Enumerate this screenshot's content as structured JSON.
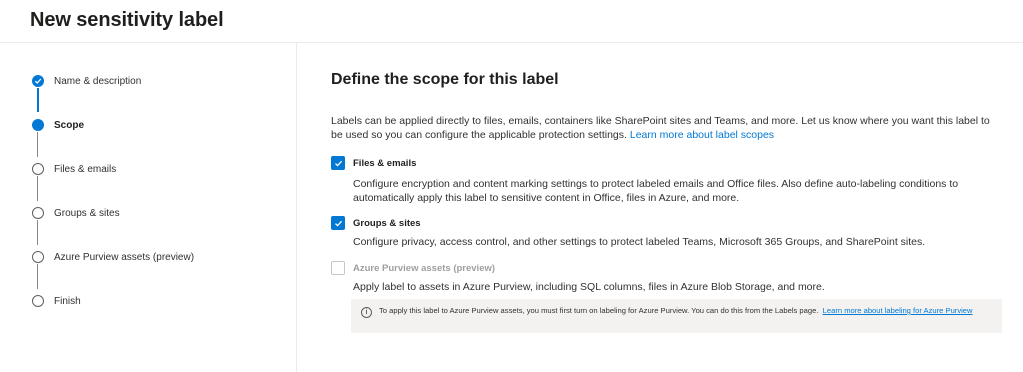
{
  "page": {
    "title": "New sensitivity label"
  },
  "wizard": {
    "steps": [
      {
        "label": "Name & description",
        "state": "completed"
      },
      {
        "label": "Scope",
        "state": "current"
      },
      {
        "label": "Files & emails",
        "state": "pending"
      },
      {
        "label": "Groups & sites",
        "state": "pending"
      },
      {
        "label": "Azure Purview assets (preview)",
        "state": "pending"
      },
      {
        "label": "Finish",
        "state": "pending"
      }
    ]
  },
  "main": {
    "heading": "Define the scope for this label",
    "intro_text": "Labels can be applied directly to files, emails, containers like SharePoint sites and Teams, and more. Let us know where you want this label to be used so you can configure the applicable protection settings.",
    "intro_link": "Learn more about label scopes",
    "options": [
      {
        "label": "Files & emails",
        "checked": true,
        "enabled": true,
        "description": "Configure encryption and content marking settings to protect labeled emails and Office files. Also define auto-labeling conditions to automatically apply this label to sensitive content in Office, files in Azure, and more."
      },
      {
        "label": "Groups & sites",
        "checked": true,
        "enabled": true,
        "description": "Configure privacy, access control, and other settings to protect labeled Teams, Microsoft 365 Groups, and SharePoint sites."
      },
      {
        "label": "Azure Purview assets (preview)",
        "checked": false,
        "enabled": false,
        "description": "Apply label to assets in Azure Purview, including SQL columns, files in Azure Blob Storage, and more."
      }
    ],
    "info": {
      "icon": "info-icon",
      "text": "To apply this label to Azure Purview assets, you must first turn on labeling for Azure Purview. You can do this from the Labels page.",
      "link": "Learn more about labeling for Azure Purview"
    }
  },
  "colors": {
    "accent": "#0078d4",
    "text": "#323130",
    "disabled": "#a19f9d",
    "info_bg": "#f3f2f1"
  }
}
